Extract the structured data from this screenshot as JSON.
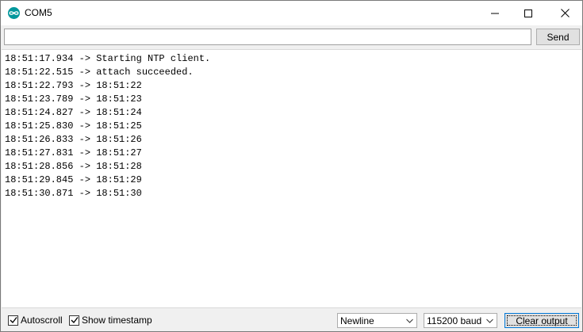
{
  "window": {
    "title": "COM5"
  },
  "send_bar": {
    "input_value": "",
    "send_label": "Send"
  },
  "output": {
    "lines": [
      "18:51:17.934 -> Starting NTP client.",
      "18:51:22.515 -> attach succeeded.",
      "18:51:22.793 -> 18:51:22",
      "18:51:23.789 -> 18:51:23",
      "18:51:24.827 -> 18:51:24",
      "18:51:25.830 -> 18:51:25",
      "18:51:26.833 -> 18:51:26",
      "18:51:27.831 -> 18:51:27",
      "18:51:28.856 -> 18:51:28",
      "18:51:29.845 -> 18:51:29",
      "18:51:30.871 -> 18:51:30"
    ]
  },
  "bottom_bar": {
    "autoscroll_label": "Autoscroll",
    "autoscroll_checked": true,
    "timestamp_label": "Show timestamp",
    "timestamp_checked": true,
    "line_ending_value": "Newline",
    "baud_value": "115200 baud",
    "clear_label": "Clear output"
  },
  "colors": {
    "app_icon": "#00979c",
    "focus_border": "#0078d7"
  },
  "icons": {
    "app": "arduino-icon",
    "minimize": "minimize-icon",
    "maximize": "maximize-icon",
    "close": "close-icon",
    "dropdown": "chevron-down-icon",
    "check": "checkmark-icon"
  }
}
